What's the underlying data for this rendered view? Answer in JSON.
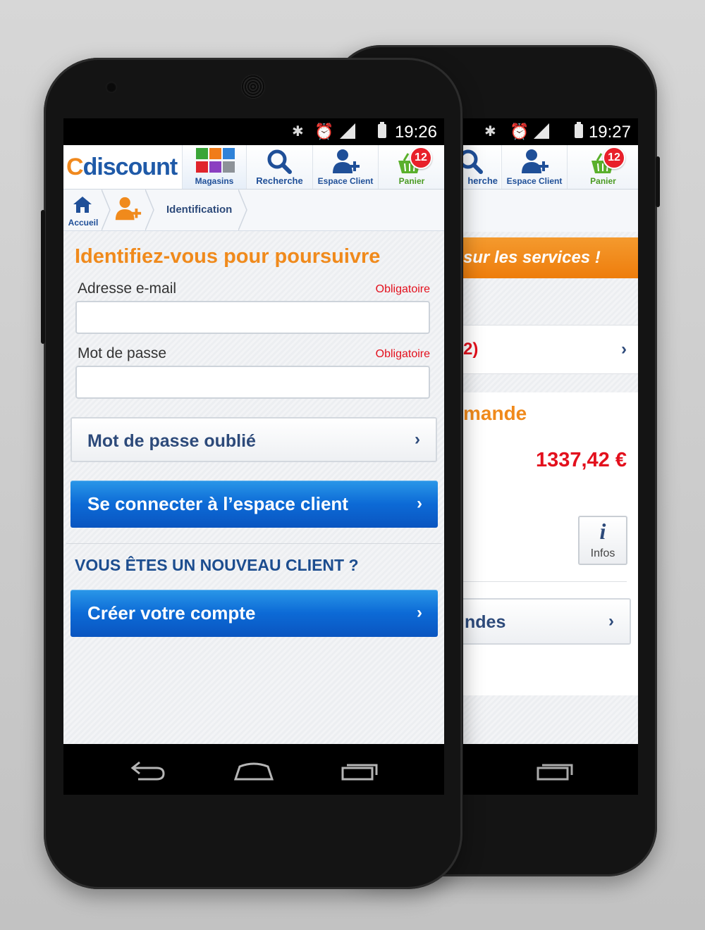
{
  "front": {
    "status": {
      "time": "19:26"
    },
    "header": {
      "logo": "Cdiscount",
      "nav": [
        {
          "label": "Magasins"
        },
        {
          "label": "Recherche"
        },
        {
          "label": "Espace Client"
        },
        {
          "label": "Panier",
          "badge": "12"
        }
      ]
    },
    "breadcrumb": {
      "home": "Accueil",
      "current": "Identification"
    },
    "form": {
      "title": "Identifiez-vous pour poursuivre",
      "email_label": "Adresse e-mail",
      "email_required": "Obligatoire",
      "email_value": "",
      "password_label": "Mot de passe",
      "password_required": "Obligatoire",
      "password_value": "",
      "forgot_label": "Mot de passe oublié",
      "login_label": "Se connecter à l’espace client",
      "new_client_heading": "VOUS ÊTES UN NOUVEAU CLIENT ?",
      "create_label": "Créer votre compte",
      "chevron": "›"
    }
  },
  "back": {
    "status": {
      "time": "19:27"
    },
    "header": {
      "nav": [
        {
          "label": "herche"
        },
        {
          "label": "Espace Client"
        },
        {
          "label": "Panier",
          "badge": "12"
        }
      ]
    },
    "banner": "sur les services !",
    "row1_text": "2)",
    "section_title": "mande",
    "amount": "1337,42 €",
    "info_label": "Infos",
    "info_glyph": "i",
    "orders_text": "ndes",
    "chevron": "›"
  },
  "colors": {
    "brand_orange": "#f08a1c",
    "brand_blue": "#1f5aa8",
    "button_blue": "#0c6ad6",
    "required_red": "#e3101d",
    "badge_red": "#e8202a"
  }
}
